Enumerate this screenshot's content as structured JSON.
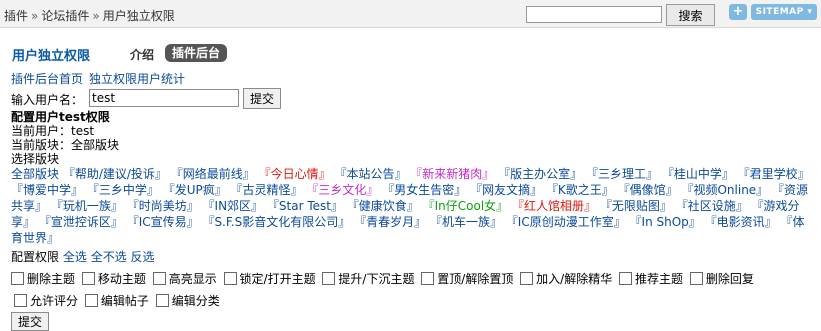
{
  "breadcrumb": [
    "插件",
    "论坛插件",
    "用户独立权限"
  ],
  "breadcrumb_sep": "»",
  "search": {
    "button": "搜索"
  },
  "topbar": {
    "plus": "+",
    "sitemap": "SITEMAP ▾"
  },
  "header": {
    "title": "用户独立权限",
    "tab_intro": "介绍",
    "tab_admin": "插件后台"
  },
  "links": [
    "插件后台首页",
    "独立权限用户统计"
  ],
  "input": {
    "label": "输入用户名：",
    "value": "test",
    "submit": "提交"
  },
  "config_title": "配置用户test权限",
  "current_user": "当前用户：test",
  "current_forum": "当前版块：全部版块",
  "select_forum": "选择版块",
  "all_forums": "全部版块",
  "forums": [
    {
      "name": "『帮助/建议/投诉』",
      "color": "blue"
    },
    {
      "name": "『网络最前线』",
      "color": "blue"
    },
    {
      "name": "『今日心情』",
      "color": "red"
    },
    {
      "name": "『本站公告』",
      "color": "blue"
    },
    {
      "name": "『新来新猪肉』",
      "color": "purple"
    },
    {
      "name": "『版主办公室』",
      "color": "blue"
    },
    {
      "name": "『三乡理工』",
      "color": "blue"
    },
    {
      "name": "『桂山中学』",
      "color": "blue"
    },
    {
      "name": "『君里学校』",
      "color": "blue"
    },
    {
      "name": "『博爱中学』",
      "color": "blue"
    },
    {
      "name": "『三乡中学』",
      "color": "blue"
    },
    {
      "name": "『发UP疯』",
      "color": "blue"
    },
    {
      "name": "『古灵精怪』",
      "color": "blue"
    },
    {
      "name": "『三乡文化』",
      "color": "purple"
    },
    {
      "name": "『男女生告密』",
      "color": "blue"
    },
    {
      "name": "『网友文摘』",
      "color": "blue"
    },
    {
      "name": "『K歌之王』",
      "color": "blue"
    },
    {
      "name": "『偶像馆』",
      "color": "blue"
    },
    {
      "name": "『视频Online』",
      "color": "blue"
    },
    {
      "name": "『资源共享』",
      "color": "blue"
    },
    {
      "name": "『玩机一族』",
      "color": "blue"
    },
    {
      "name": "『时尚美坊』",
      "color": "blue"
    },
    {
      "name": "『IN郊区』",
      "color": "blue"
    },
    {
      "name": "『Star Test』",
      "color": "blue"
    },
    {
      "name": "『健康饮食』",
      "color": "blue"
    },
    {
      "name": "『In仔Cool女』",
      "color": "green"
    },
    {
      "name": "『红人馆相册』",
      "color": "red"
    },
    {
      "name": "『无限贴图』",
      "color": "blue"
    },
    {
      "name": "『社区设施』",
      "color": "blue"
    },
    {
      "name": "『游戏分享』",
      "color": "blue"
    },
    {
      "name": "『宣泄控诉区』",
      "color": "blue"
    },
    {
      "name": "『IC宣传易』",
      "color": "blue"
    },
    {
      "name": "『S.F.S影音文化有限公司』",
      "color": "blue"
    },
    {
      "name": "『青春岁月』",
      "color": "blue"
    },
    {
      "name": "『机车一族』",
      "color": "blue"
    },
    {
      "name": "『IC原创动漫工作室』",
      "color": "blue"
    },
    {
      "name": "『In ShOp』",
      "color": "blue"
    },
    {
      "name": "『电影资讯』",
      "color": "blue"
    },
    {
      "name": "『体育世界』",
      "color": "blue"
    }
  ],
  "colors": {
    "blue": "#0b4a9a",
    "red": "#e0140e",
    "purple": "#c12ec6",
    "green": "#11a111"
  },
  "perm_header": {
    "label": "配置权限",
    "select_all": "全选",
    "select_none": "全不选",
    "invert": "反选"
  },
  "perms": [
    "删除主题",
    "移动主题",
    "高亮显示",
    "锁定/打开主题",
    "提升/下沉主题",
    "置顶/解除置顶",
    "加入/解除精华",
    "推荐主题",
    "删除回复",
    "允许评分",
    "编辑帖子",
    "编辑分类"
  ],
  "submit": "提交"
}
